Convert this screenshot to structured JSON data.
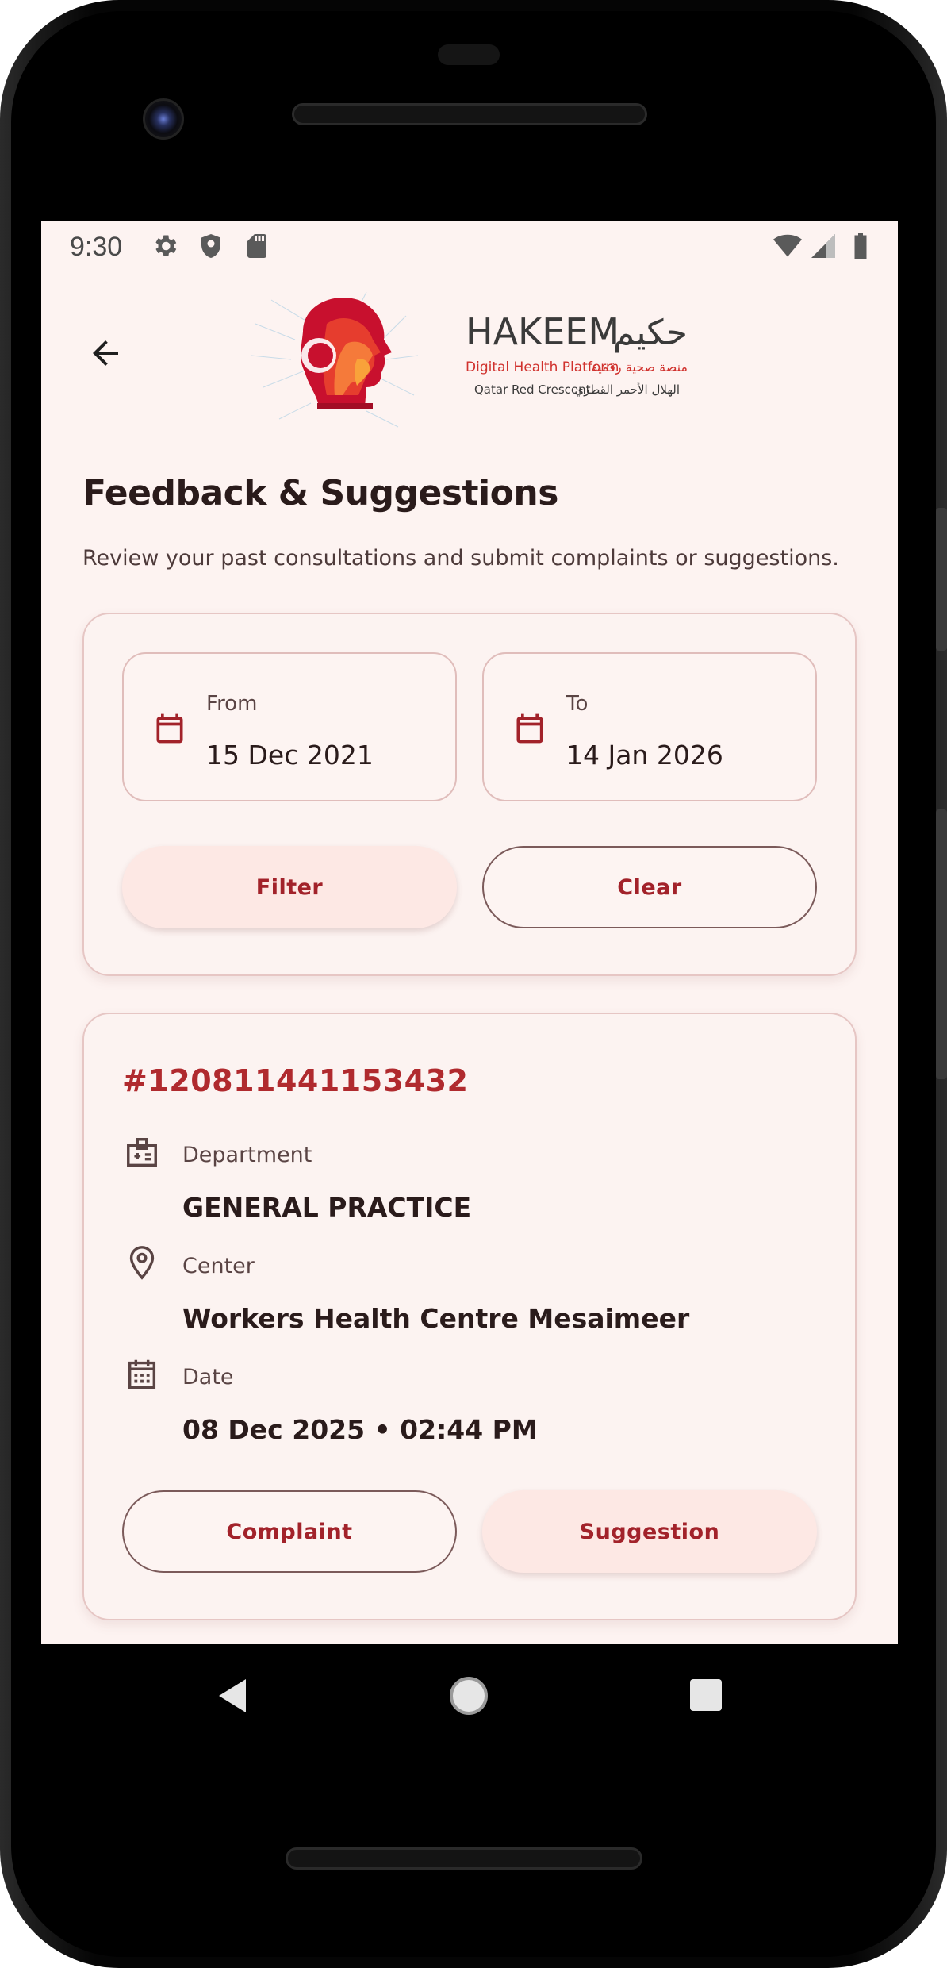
{
  "status_bar": {
    "time": "9:30",
    "left_icons": [
      "gear-icon",
      "shield-icon",
      "sd-card-icon"
    ],
    "right_icons": [
      "wifi-icon",
      "signal-icon",
      "battery-icon"
    ]
  },
  "header": {
    "logo": {
      "brand": "HAKEEM",
      "brand_arabic": "حكيم",
      "tagline": "Digital Health Platform",
      "tagline_arabic": "منصة صحية رقمية",
      "org": "Qatar Red Crescent",
      "org_arabic": "الهلال الأحمر القطري"
    }
  },
  "page": {
    "title": "Feedback & Suggestions",
    "subtitle": "Review your past consultations and submit complaints or suggestions."
  },
  "filter": {
    "from_label": "From",
    "from_value": "15 Dec 2021",
    "to_label": "To",
    "to_value": "14 Jan 2026",
    "filter_button": "Filter",
    "clear_button": "Clear"
  },
  "consultation": {
    "id": "#12081144115343​2",
    "department_label": "Department",
    "department_value": "GENERAL PRACTICE",
    "center_label": "Center",
    "center_value": "Workers Health Centre Mesaimeer",
    "date_label": "Date",
    "date_value": "08 Dec 2025 • 02:44 PM",
    "complaint_button": "Complaint",
    "suggestion_button": "Suggestion"
  },
  "colors": {
    "accent": "#b02a2e",
    "background": "#fdf3f1",
    "card_border": "#e6c6c4"
  }
}
